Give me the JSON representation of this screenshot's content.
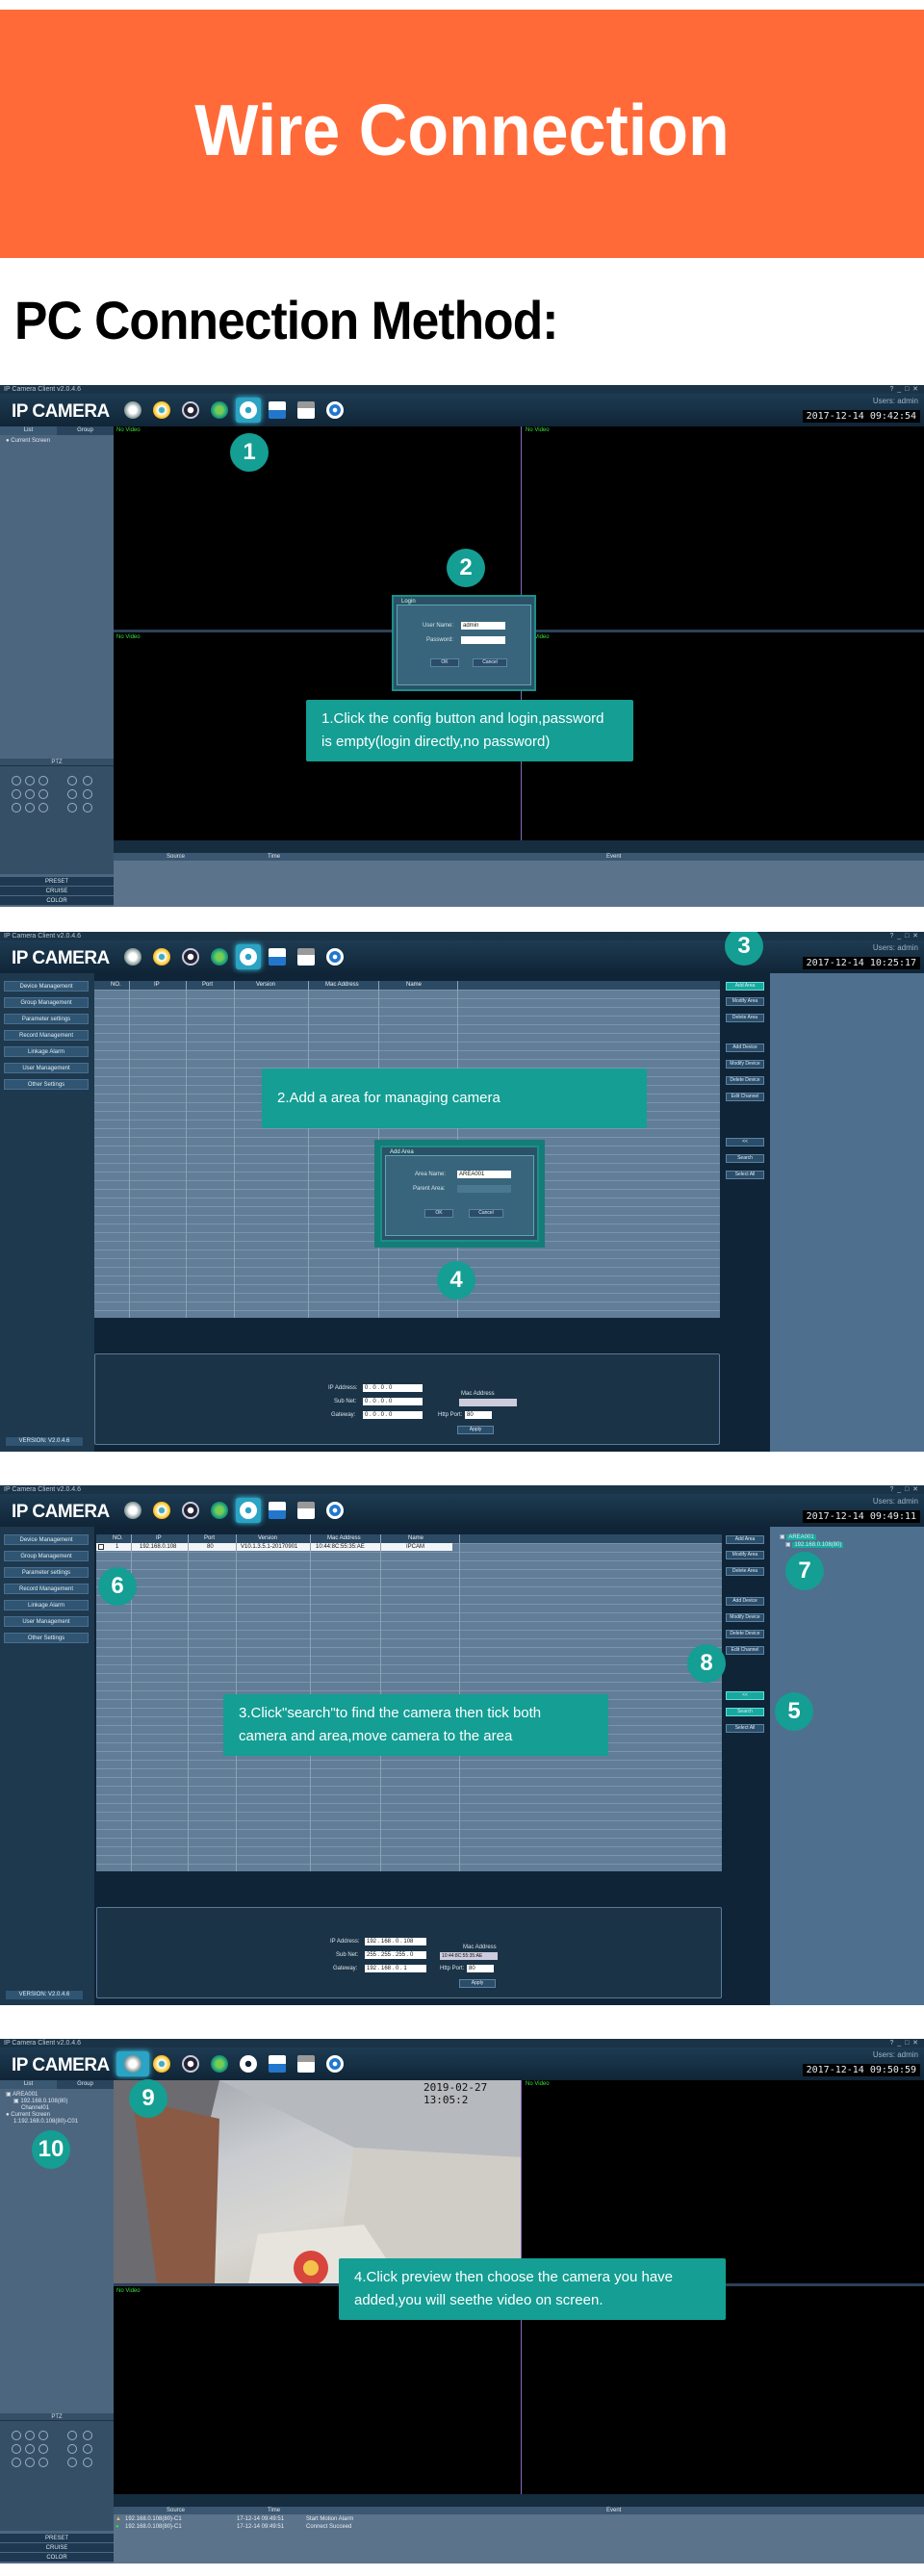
{
  "banner": {
    "title": "Wire Connection"
  },
  "heading": "PC Connection Method:",
  "app": {
    "window_title": "IP Camera Client v2.0.4.6",
    "logo": "IP CAMERA",
    "users_label": "Users: admin"
  },
  "colors": {
    "banner": "#ff6a38",
    "callout": "#149e94",
    "highlight": "#2aa3c4"
  },
  "icons": [
    "camera-icon",
    "play-icon",
    "aperture-icon",
    "globe-icon",
    "gear-icon",
    "save-icon",
    "lock-icon",
    "power-icon"
  ],
  "panel1": {
    "clock": "2017-12-14 09:42:54",
    "tabs": [
      "List",
      "Group"
    ],
    "tree_item": "Current Screen",
    "ptz_title": "PTZ",
    "bottom_buttons": [
      "PRESET",
      "CRUISE",
      "COLOR"
    ],
    "video_labels": [
      "No Video",
      "No Video",
      "No Video",
      "No Video"
    ],
    "log_headers": [
      "Source",
      "Time",
      "Event"
    ],
    "dialog": {
      "title": "Login",
      "user_label": "User Name:",
      "user_value": "admin",
      "pass_label": "Password:",
      "ok": "OK",
      "cancel": "Cancel"
    },
    "callout": "1.Click the config button and login,password is empty(login directly,no password)",
    "step_numbers": [
      "1",
      "2"
    ]
  },
  "panel2": {
    "clock": "2017-12-14 10:25:17",
    "menu": [
      "Device Management",
      "Group Management",
      "Parameter settings",
      "Record Management",
      "Linkage Alarm",
      "User Management",
      "Other Settings"
    ],
    "version": "VERSION: V2.0.4.6",
    "columns": [
      "NO.",
      "IP",
      "Port",
      "Version",
      "Mac Address",
      "Name"
    ],
    "right_buttons": [
      "Add Area",
      "Modify Area",
      "Delete Area",
      "Add Device",
      "Modify Device",
      "Delete Device",
      "Edit Channel",
      "<<",
      "Search",
      "Select All"
    ],
    "net": {
      "ip_label": "IP Address:",
      "ip": "0 . 0 . 0 . 0",
      "mask_label": "Sub Net:",
      "mask": "0 . 0 . 0 . 0",
      "gw_label": "Gateway:",
      "gw": "0 . 0 . 0 . 0",
      "mac_label": "Mac Address",
      "http_label": "Http Port:",
      "http": "80",
      "apply": "Apply"
    },
    "dialog": {
      "title": "Add Area",
      "area_label": "Area Name:",
      "area_value": "AREA001",
      "parent_label": "Parent Area:",
      "ok": "OK",
      "cancel": "Cancel"
    },
    "callout": "2.Add a area for managing camera",
    "step_numbers": [
      "3",
      "4"
    ]
  },
  "panel3": {
    "clock": "2017-12-14 09:49:11",
    "row": {
      "no": "1",
      "ip": "192.168.0.108",
      "port": "80",
      "version": "V10.1.3.5.1-20170901",
      "mac": "10:44:8C:55:35:AE",
      "name": "IPCAM"
    },
    "area_tree": [
      "AREA001",
      "192.168.0.108(80)"
    ],
    "net": {
      "ip": "192 . 168 . 0 . 108",
      "mask": "255 . 255 . 255 . 0",
      "gw": "192 . 168 . 0 . 1",
      "mac": "10:44:8C:55:35:AE",
      "http": "80"
    },
    "callout": "3.Click\"search\"to find the camera then tick both camera and area,move camera to the area",
    "step_numbers": [
      "5",
      "6",
      "7",
      "8"
    ]
  },
  "panel4": {
    "clock": "2017-12-14 09:50:59",
    "osd_time": "2019-02-27 13:05:2",
    "tree": [
      "AREA001",
      "192.168.0.108(80)",
      "Channel01",
      "Current Screen",
      "1:192.168.0.108(80)-C01"
    ],
    "log_rows": [
      {
        "source": "192.168.0.108(80)-C1",
        "time": "17-12-14 09:49:51",
        "event": "Start Motion Alarm"
      },
      {
        "source": "192.168.0.108(80)-C1",
        "time": "17-12-14 09:49:51",
        "event": "Connect Succeed"
      }
    ],
    "callout": "4.Click preview then choose the camera you have added,you will seethe video on screen.",
    "step_numbers": [
      "9",
      "10"
    ]
  }
}
